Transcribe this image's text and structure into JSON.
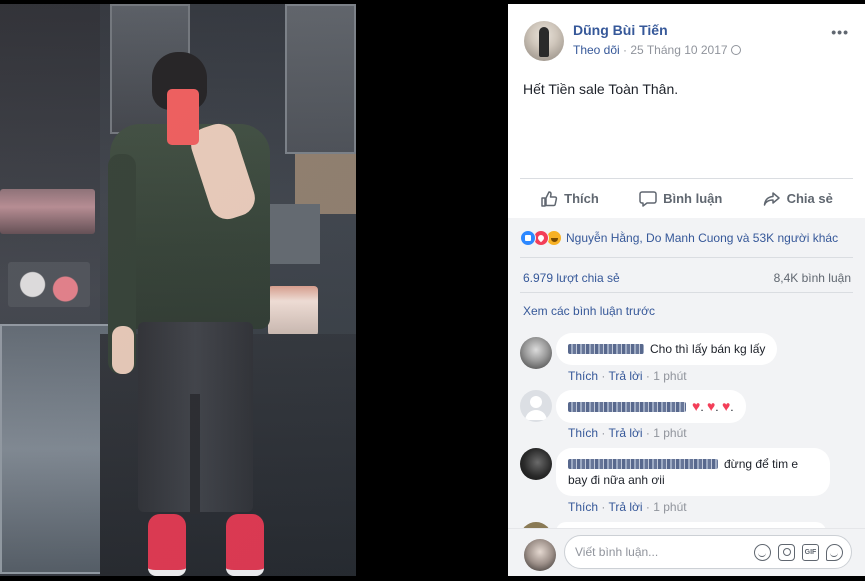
{
  "post": {
    "author": "Dũng Bùi Tiến",
    "follow_label": "Theo dõi",
    "separator": " · ",
    "date": "25 Tháng 10 2017",
    "more_icon": "more-icon",
    "text": "Hết Tiền sale Toàn Thân."
  },
  "actions": {
    "like": "Thích",
    "comment": "Bình luận",
    "share": "Chia sẻ"
  },
  "reactions": {
    "icons": [
      "like-reaction-icon",
      "love-reaction-icon",
      "haha-reaction-icon"
    ],
    "summary": "Nguyễn Hằng, Do Manh Cuong và 53K người khác"
  },
  "stats": {
    "shares": "6.979 lượt chia sẻ",
    "comments": "8,4K bình luận"
  },
  "view_previous": "Xem các bình luận trước",
  "comments": [
    {
      "text": "Cho thì lấy bán kg lấy",
      "like": "Thích",
      "reply": "Trả lời",
      "time": "1 phút"
    },
    {
      "text": ".",
      "like": "Thích",
      "reply": "Trả lời",
      "time": "1 phút"
    },
    {
      "text_line1": "đừng để tim e",
      "text_line2": "bay đi nữa anh ơii",
      "like": "Thích",
      "reply": "Trả lời",
      "time": "1 phút"
    }
  ],
  "composer": {
    "placeholder": "Viết bình luận...",
    "gif_label": "GIF"
  },
  "colors": {
    "link": "#365899",
    "muted": "#90949c",
    "like_blue": "#2d88ff",
    "love_red": "#f33e58",
    "shoe_red": "#e0324a"
  }
}
